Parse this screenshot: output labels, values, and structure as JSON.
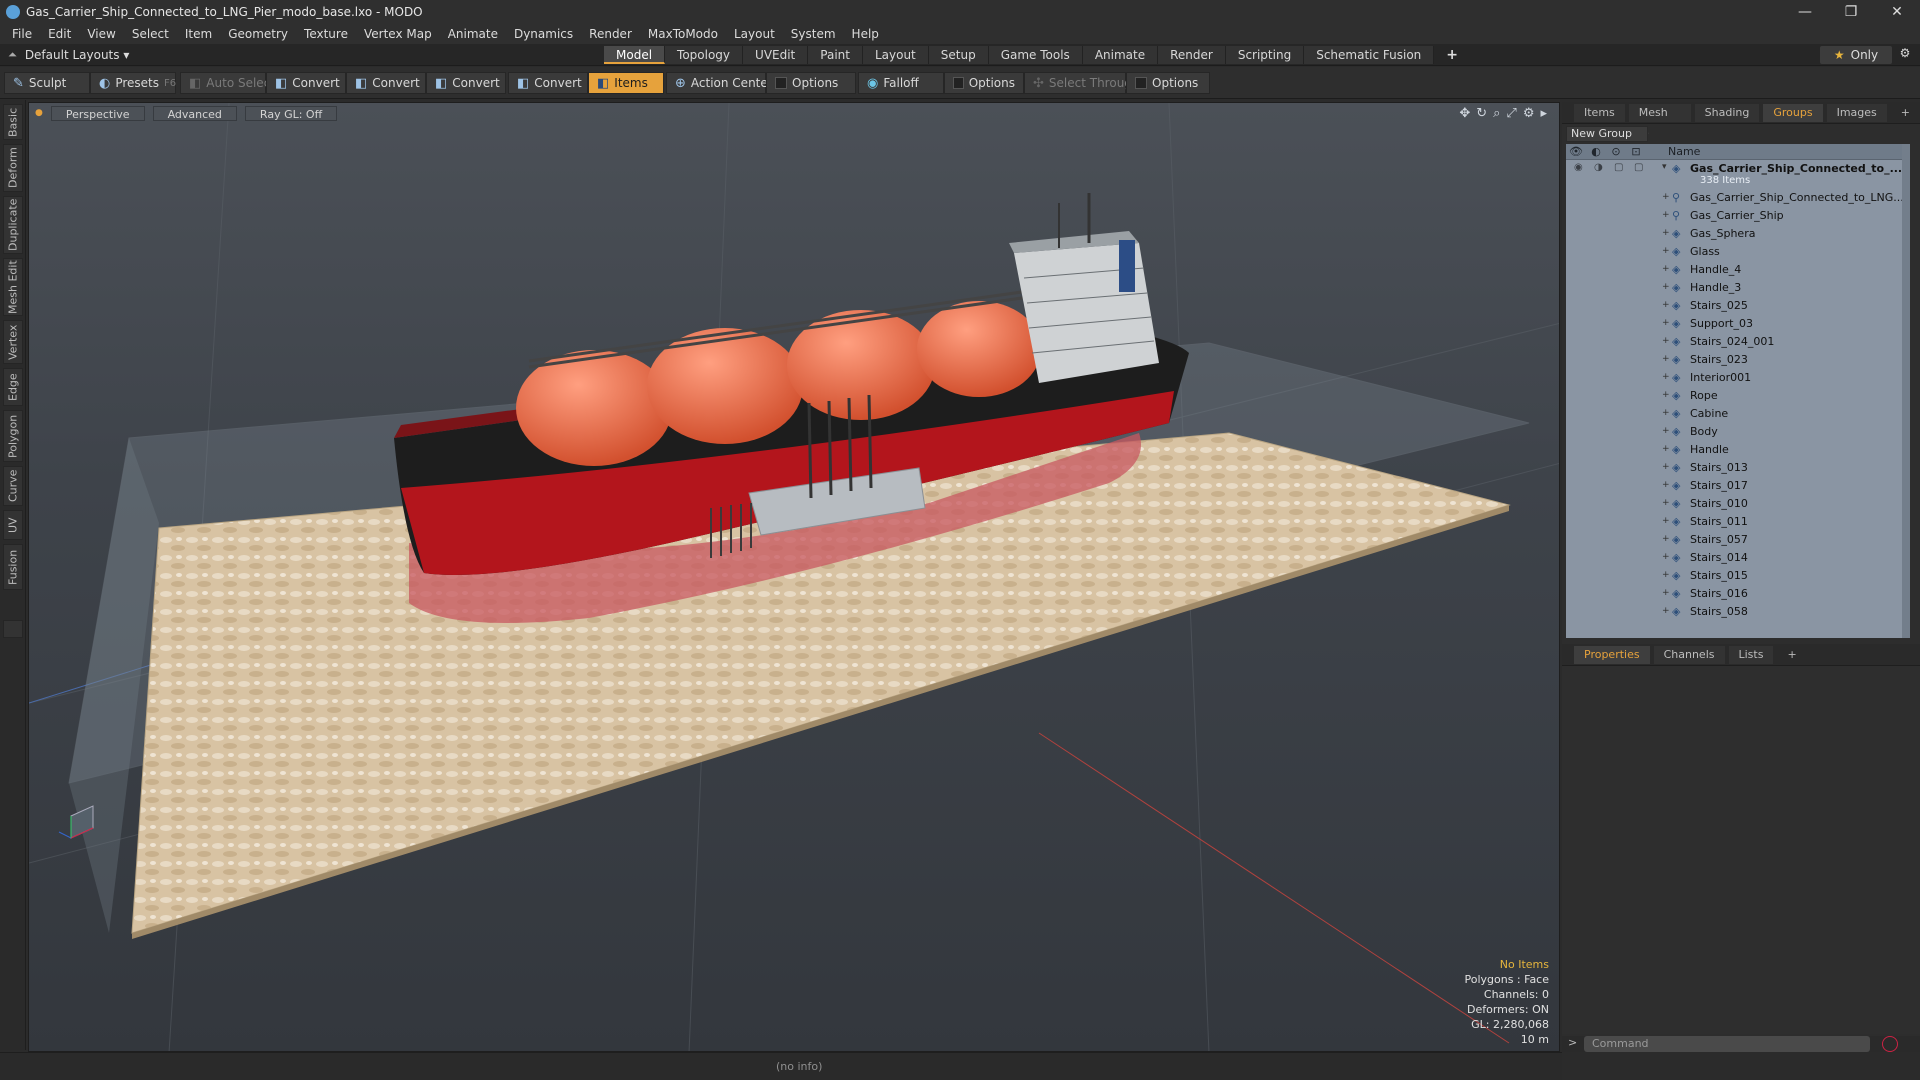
{
  "window": {
    "title": "Gas_Carrier_Ship_Connected_to_LNG_Pier_modo_base.lxo - MODO",
    "controls": [
      "—",
      "❐",
      "✕"
    ]
  },
  "menu": [
    "File",
    "Edit",
    "View",
    "Select",
    "Item",
    "Geometry",
    "Texture",
    "Vertex Map",
    "Animate",
    "Dynamics",
    "Render",
    "MaxToModo",
    "Layout",
    "System",
    "Help"
  ],
  "layout_selector": "Default Layouts ▾",
  "tabs": [
    "Model",
    "Topology",
    "UVEdit",
    "Paint",
    "Layout",
    "Setup",
    "Game Tools",
    "Animate",
    "Render",
    "Scripting",
    "Schematic Fusion"
  ],
  "active_tab": "Model",
  "only_label": "Only",
  "toolbar": {
    "sculpt": "Sculpt",
    "presets": "Presets",
    "presets_key": "F6",
    "auto_select": "Auto Select",
    "convert": "Convert",
    "items": "Items",
    "action_center": "Action Center",
    "options": "Options",
    "falloff": "Falloff",
    "select_through": "Select Through"
  },
  "left_tabs": [
    "Basic",
    "Deform",
    "Duplicate",
    "Mesh Edit",
    "Vertex",
    "Edge",
    "Polygon",
    "Curve",
    "UV",
    "Fusion"
  ],
  "viewport": {
    "perspective": "Perspective",
    "advanced": "Advanced",
    "raygl": "Ray GL: Off",
    "info": {
      "items": "No Items",
      "polygons": "Polygons : Face",
      "channels": "Channels: 0",
      "deformers": "Deformers: ON",
      "gl": "GL: 2,280,068",
      "scale": "10 m"
    }
  },
  "panel_tabs": [
    "Items",
    "Mesh ...",
    "Shading",
    "Groups",
    "Images"
  ],
  "active_panel_tab": "Groups",
  "new_group": "New Group",
  "groups": {
    "header_name": "Name",
    "root": "Gas_Carrier_Ship_Connected_to_...",
    "root_count": "338 Items",
    "items": [
      "Gas_Carrier_Ship_Connected_to_LNG...",
      "Gas_Carrier_Ship",
      "Gas_Sphera",
      "Glass",
      "Handle_4",
      "Handle_3",
      "Stairs_025",
      "Support_03",
      "Stairs_024_001",
      "Stairs_023",
      "Interior001",
      "Rope",
      "Cabine",
      "Body",
      "Handle",
      "Stairs_013",
      "Stairs_017",
      "Stairs_010",
      "Stairs_011",
      "Stairs_057",
      "Stairs_014",
      "Stairs_015",
      "Stairs_016",
      "Stairs_058"
    ]
  },
  "props_tabs": [
    "Properties",
    "Channels",
    "Lists"
  ],
  "active_props_tab": "Properties",
  "command_placeholder": "Command",
  "status_info": "(no info)",
  "colors": {
    "accent": "#e6a23c",
    "hull_red": "#b3151c",
    "tank_orange": "#ee6a45"
  }
}
